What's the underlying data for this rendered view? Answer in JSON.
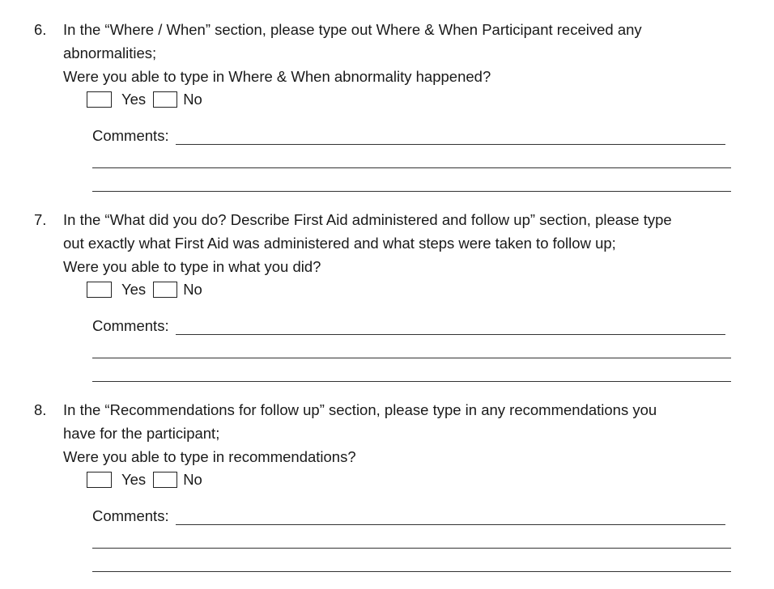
{
  "questions": [
    {
      "number": "6.",
      "lines": [
        "In the “Where / When” section, please type out Where & When Participant received any",
        "abnormalities;",
        "Were you able to type in Where & When abnormality happened?"
      ],
      "yes_label": "Yes",
      "no_label": "No",
      "comments_label": "Comments:"
    },
    {
      "number": "7.",
      "lines": [
        "In the “What did you do? Describe First Aid administered and follow up” section, please type",
        "out exactly what First Aid was administered and what steps were taken to follow up;",
        "Were you able to type in what you did?"
      ],
      "yes_label": "Yes",
      "no_label": "No",
      "comments_label": "Comments:"
    },
    {
      "number": "8.",
      "lines": [
        "In the “Recommendations for follow up” section, please type in any recommendations you",
        "have for the participant;",
        "Were you able to type in recommendations?"
      ],
      "yes_label": "Yes",
      "no_label": "No",
      "comments_label": "Comments:"
    }
  ]
}
